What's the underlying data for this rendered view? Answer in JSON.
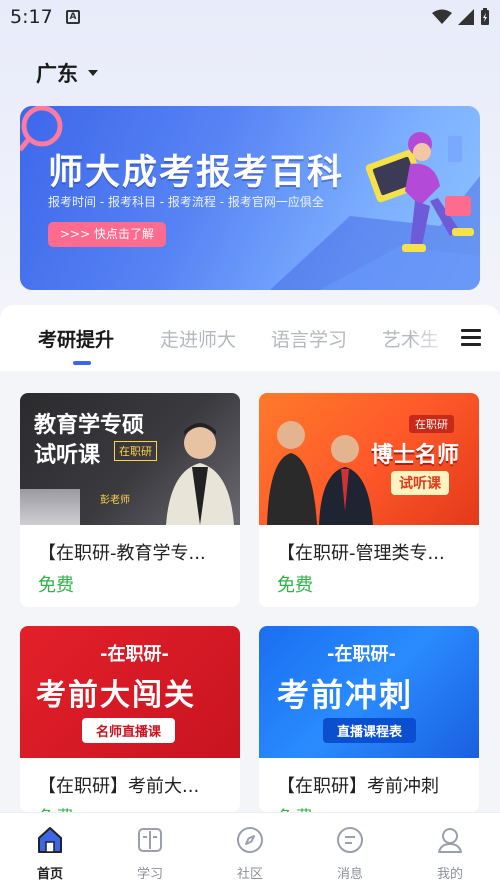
{
  "status_bar": {
    "time": "5:17",
    "app_badge": "A"
  },
  "region": {
    "label": "广东"
  },
  "banner": {
    "title": "师大成考报考百科",
    "subtitle": "报考时间 - 报考科目 - 报考流程 - 报考官网一应俱全",
    "cta": ">>> 快点击了解"
  },
  "tabs": [
    {
      "label": "考研提升",
      "active": true
    },
    {
      "label": "走进师大",
      "active": false
    },
    {
      "label": "语言学习",
      "active": false
    },
    {
      "label": "艺术生",
      "active": false
    }
  ],
  "courses": [
    {
      "title": "【在职研-教育学专...",
      "price": "免费",
      "thumb_line1": "教育学专硕",
      "thumb_line2": "试听课",
      "thumb_tag": "在职研",
      "thumb_teacher": "彭老师"
    },
    {
      "title": "【在职研-管理类专...",
      "price": "免费",
      "thumb_tag": "在职研",
      "thumb_line1": "博士名师",
      "thumb_line2": "试听课"
    },
    {
      "title": "【在职研】考前大...",
      "price": "免费",
      "thumb_line0": "-在职研-",
      "thumb_line1": "考前大闯关",
      "thumb_button": "名师直播课"
    },
    {
      "title": "【在职研】考前冲刺",
      "price": "免费",
      "thumb_line0": "-在职研-",
      "thumb_line1": "考前冲刺",
      "thumb_button": "直播课程表"
    }
  ],
  "bottom_nav": [
    {
      "label": "首页",
      "icon": "home-icon",
      "active": true
    },
    {
      "label": "学习",
      "icon": "book-icon",
      "active": false
    },
    {
      "label": "社区",
      "icon": "compass-icon",
      "active": false
    },
    {
      "label": "消息",
      "icon": "message-icon",
      "active": false
    },
    {
      "label": "我的",
      "icon": "user-icon",
      "active": false
    }
  ],
  "colors": {
    "accent": "#3d66e6",
    "price": "#2fb34a",
    "cta": "#ff6a8f"
  }
}
